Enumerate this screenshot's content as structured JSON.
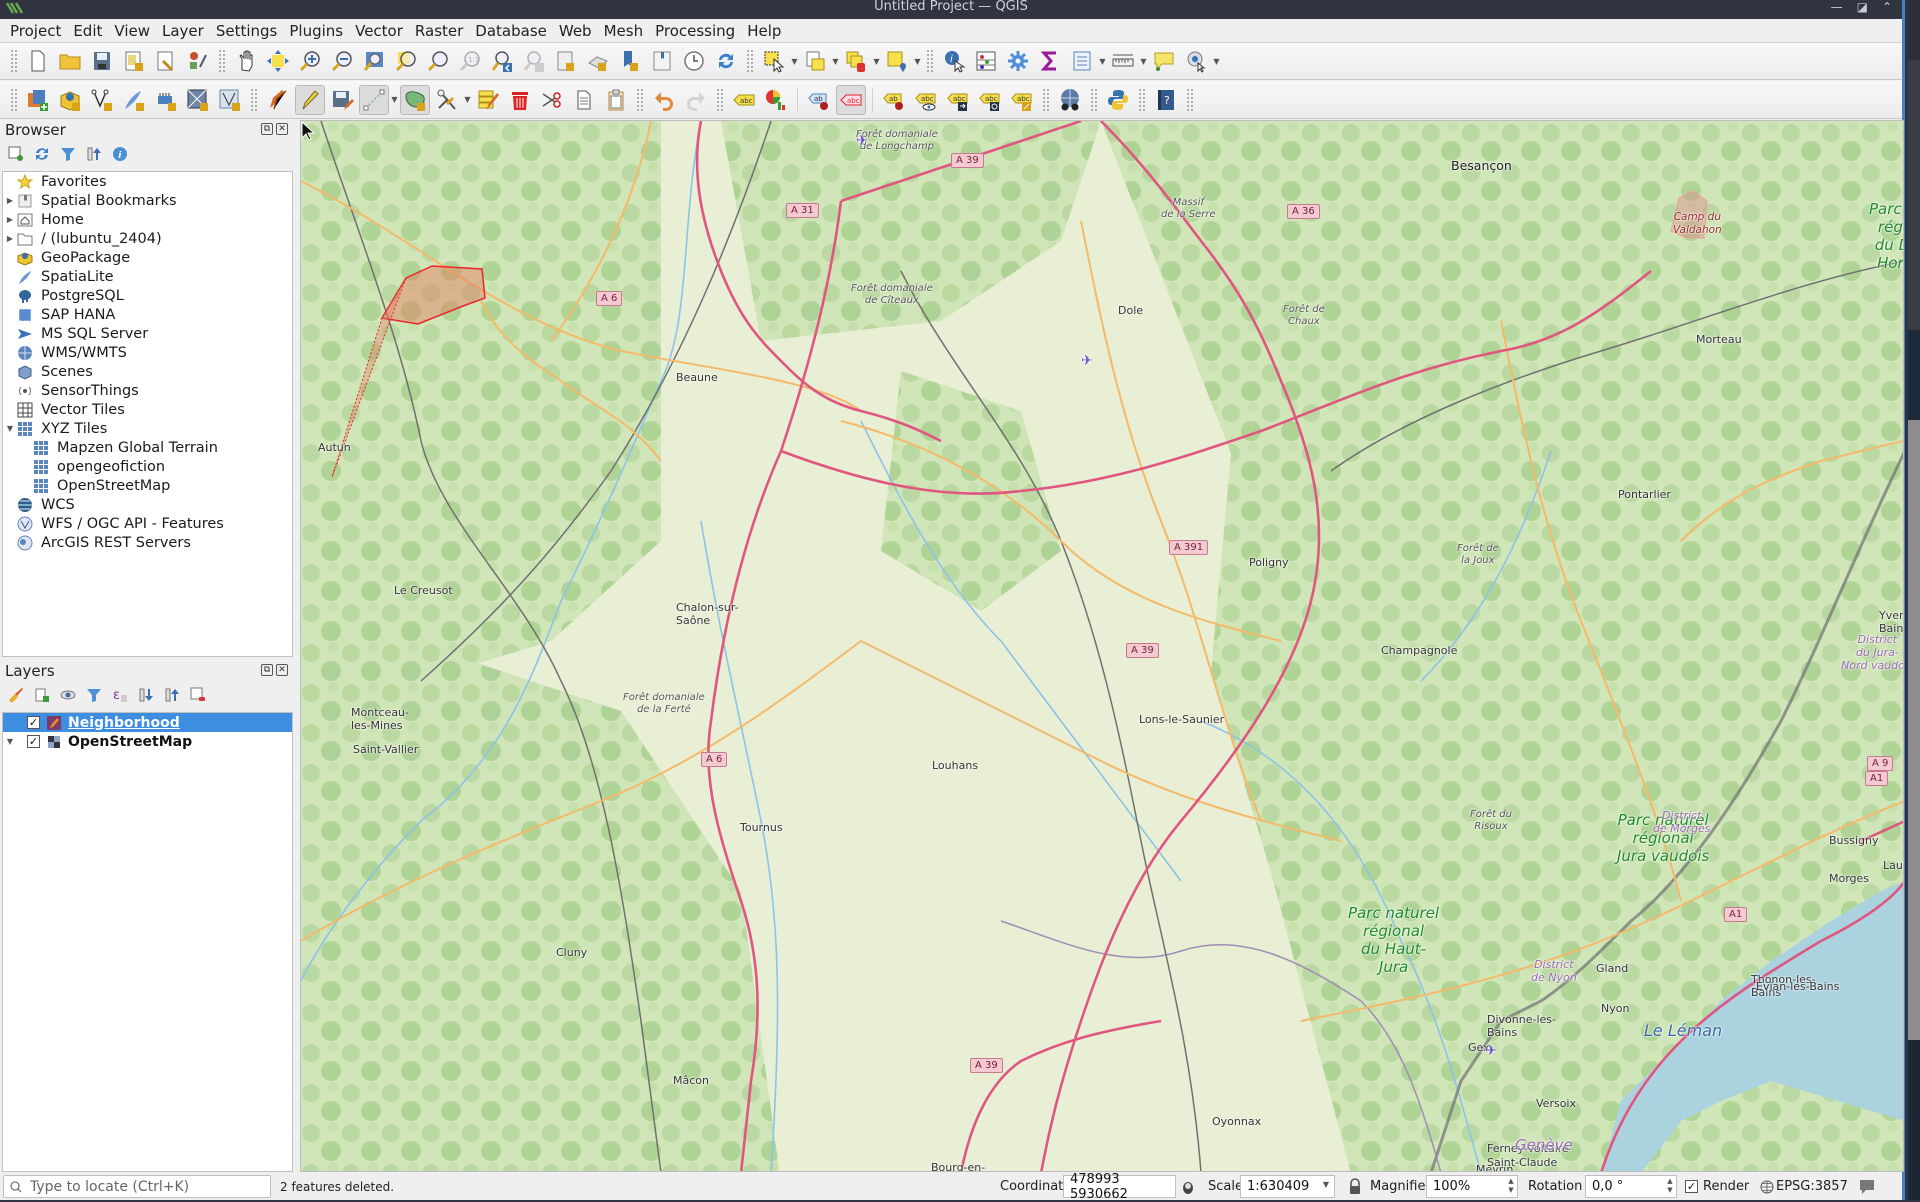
{
  "window": {
    "title": "Untitled Project — QGIS",
    "controls": [
      "minimize",
      "maximize",
      "close"
    ]
  },
  "menubar": [
    "Project",
    "Edit",
    "View",
    "Layer",
    "Settings",
    "Plugins",
    "Vector",
    "Raster",
    "Database",
    "Web",
    "Mesh",
    "Processing",
    "Help"
  ],
  "toolbar1": [
    "new-project-icon",
    "open-project-icon",
    "save-project-icon",
    "new-print-layout-icon",
    "layout-manager-icon",
    "style-manager-icon",
    "pan-icon",
    "pan-to-selection-icon",
    "zoom-in-icon",
    "zoom-out-icon",
    "zoom-full-icon",
    "zoom-to-selection-icon",
    "zoom-to-layer-icon",
    "zoom-native-icon",
    "zoom-last-icon",
    "zoom-next-icon",
    "new-map-view-icon",
    "new-3d-view-icon",
    "new-bookmark-icon",
    "show-bookmarks-icon",
    "temporal-controller-icon",
    "refresh-icon",
    "select-features-icon",
    "select-by-value-icon",
    "deselect-features-icon",
    "select-by-location-icon",
    "identify-icon",
    "open-attribute-table-icon",
    "processing-toolbox-icon",
    "statistical-summary-icon",
    "field-calculator-icon",
    "measure-icon",
    "map-tips-icon",
    "locator-icon"
  ],
  "toolbar2": [
    "data-source-manager-icon",
    "new-geopackage-layer-icon",
    "new-shapefile-layer-icon",
    "new-spatialite-layer-icon",
    "new-temporary-layer-icon",
    "new-virtual-layer-icon",
    "new-mesh-layer-icon",
    "current-edits-icon",
    "toggle-editing-icon",
    "save-layer-edits-icon",
    "digitize-line-icon",
    "add-polygon-feature-icon",
    "vertex-tool-icon",
    "modify-attributes-icon",
    "delete-selected-icon",
    "cut-features-icon",
    "copy-features-icon",
    "paste-features-icon",
    "undo-icon",
    "redo-icon",
    "label-toolbar-icon",
    "diagram-options-icon",
    "pin-labels-icon",
    "highlight-pinned-labels-icon",
    "move-label-icon",
    "show-hide-labels-icon",
    "move-label-arrow-icon",
    "rotate-label-icon",
    "change-label-icon",
    "metasearch-icon",
    "python-console-icon",
    "help-icon"
  ],
  "browser": {
    "title": "Browser",
    "tools": [
      "add-selected-layers-icon",
      "refresh-icon",
      "filter-icon",
      "collapse-all-icon",
      "properties-icon"
    ],
    "items": [
      {
        "label": "Favorites",
        "icon": "star-icon",
        "expandable": false
      },
      {
        "label": "Spatial Bookmarks",
        "icon": "bookmarks-icon",
        "expandable": true
      },
      {
        "label": "Home",
        "icon": "home-folder-icon",
        "expandable": true
      },
      {
        "label": "/ (lubuntu_2404)",
        "icon": "folder-icon",
        "expandable": true
      },
      {
        "label": "GeoPackage",
        "icon": "geopackage-icon",
        "expandable": false
      },
      {
        "label": "SpatiaLite",
        "icon": "spatialite-icon",
        "expandable": false
      },
      {
        "label": "PostgreSQL",
        "icon": "postgresql-icon",
        "expandable": false
      },
      {
        "label": "SAP HANA",
        "icon": "sap-hana-icon",
        "expandable": false
      },
      {
        "label": "MS SQL Server",
        "icon": "mssql-icon",
        "expandable": false
      },
      {
        "label": "WMS/WMTS",
        "icon": "wms-icon",
        "expandable": false
      },
      {
        "label": "Scenes",
        "icon": "scenes-icon",
        "expandable": false
      },
      {
        "label": "SensorThings",
        "icon": "sensorthings-icon",
        "expandable": false
      },
      {
        "label": "Vector Tiles",
        "icon": "vector-tiles-icon",
        "expandable": false
      },
      {
        "label": "XYZ Tiles",
        "icon": "xyz-tiles-icon",
        "expandable": true,
        "expanded": true,
        "children": [
          {
            "label": "Mapzen Global Terrain",
            "icon": "xyz-tiles-icon"
          },
          {
            "label": "opengeofiction",
            "icon": "xyz-tiles-icon"
          },
          {
            "label": "OpenStreetMap",
            "icon": "xyz-tiles-icon"
          }
        ]
      },
      {
        "label": "WCS",
        "icon": "wcs-icon",
        "expandable": false
      },
      {
        "label": "WFS / OGC API - Features",
        "icon": "wfs-icon",
        "expandable": false
      },
      {
        "label": "ArcGIS REST Servers",
        "icon": "arcgis-icon",
        "expandable": false
      }
    ]
  },
  "layers": {
    "title": "Layers",
    "tools": [
      "layer-styling-icon",
      "add-group-icon",
      "manage-visibility-icon",
      "filter-legend-icon",
      "filter-by-expression-icon",
      "expand-all-icon",
      "collapse-all-icon",
      "remove-layer-icon"
    ],
    "items": [
      {
        "label": "Neighborhood",
        "checked": true,
        "selected": true,
        "editing": true,
        "icon": "editing-pencil-icon"
      },
      {
        "label": "OpenStreetMap",
        "checked": true,
        "selected": false,
        "icon": "raster-tile-icon",
        "expandable": true
      }
    ]
  },
  "map": {
    "basemap": "OpenStreetMap",
    "places": [
      {
        "name": "Besançon",
        "cls": "big"
      },
      {
        "name": "Dole"
      },
      {
        "name": "Beaune"
      },
      {
        "name": "Autun"
      },
      {
        "name": "Le Creusot"
      },
      {
        "name": "Chalon-sur-\nSaône"
      },
      {
        "name": "Montceau-\nles-Mines"
      },
      {
        "name": "Saint-Vallier"
      },
      {
        "name": "Poligny"
      },
      {
        "name": "Pontarlier"
      },
      {
        "name": "Champagnole"
      },
      {
        "name": "Lons-le-Saunier"
      },
      {
        "name": "Louhans"
      },
      {
        "name": "Tournus"
      },
      {
        "name": "Cluny"
      },
      {
        "name": "Mâcon"
      },
      {
        "name": "Morteau"
      },
      {
        "name": "Morges"
      },
      {
        "name": "Bussigny"
      },
      {
        "name": "Lausanne"
      },
      {
        "name": "Gland"
      },
      {
        "name": "Nyon"
      },
      {
        "name": "Divonne-les-\nBains"
      },
      {
        "name": "Gex"
      },
      {
        "name": "Versoix"
      },
      {
        "name": "Ferney-Voltaire"
      },
      {
        "name": "Meyrin"
      },
      {
        "name": "Thonon-les-\nBains"
      },
      {
        "name": "Évian-les-Bains"
      },
      {
        "name": "Saint-Claude"
      },
      {
        "name": "Oyonnax"
      },
      {
        "name": "Bourg-en-"
      },
      {
        "name": "Yverdon-\nBain"
      }
    ],
    "forests": [
      "Forêt domaniale\nde Longchamp",
      "Forêt domaniale\nde Cîteaux",
      "Massif\nde la Serre",
      "Forêt de\nChaux",
      "Forêt domaniale\nde la Ferté",
      "Forêt de\nla Joux",
      "Forêt du\nRisoux"
    ],
    "parks": [
      "Parc naturel\nrégional\ndu Haut-\nJura",
      "Parc naturel\nrégional\nJura vaudois",
      "Parc n\nrégi\ndu D\nHori"
    ],
    "districts": [
      "District\nde Nyon",
      "District\nde Morges",
      "District\ndu Jura-\nNord vaudois"
    ],
    "lake": "Le Léman",
    "city_purple": "Genève",
    "camp": "Camp du\nValdahon",
    "shields": [
      "A 39",
      "A 31",
      "A 6",
      "A 36",
      "A 391",
      "A 39",
      "A 6",
      "A 39",
      "A1",
      "A 9",
      "A1"
    ],
    "digitizing": {
      "layer": "Neighborhood",
      "in_progress_polygon_vertices": 7
    }
  },
  "statusbar": {
    "locator_placeholder": "Type to locate (Ctrl+K)",
    "message": "2 features deleted.",
    "coordinate_label": "Coordinate",
    "coordinate_value": "478993  5930662",
    "scale_label": "Scale",
    "scale_value": "1:630409",
    "magnifier_label": "Magnifier",
    "magnifier_value": "100%",
    "rotation_label": "Rotation",
    "rotation_value": "0,0 °",
    "render_label": "Render",
    "render_checked": true,
    "crs": "EPSG:3857"
  }
}
